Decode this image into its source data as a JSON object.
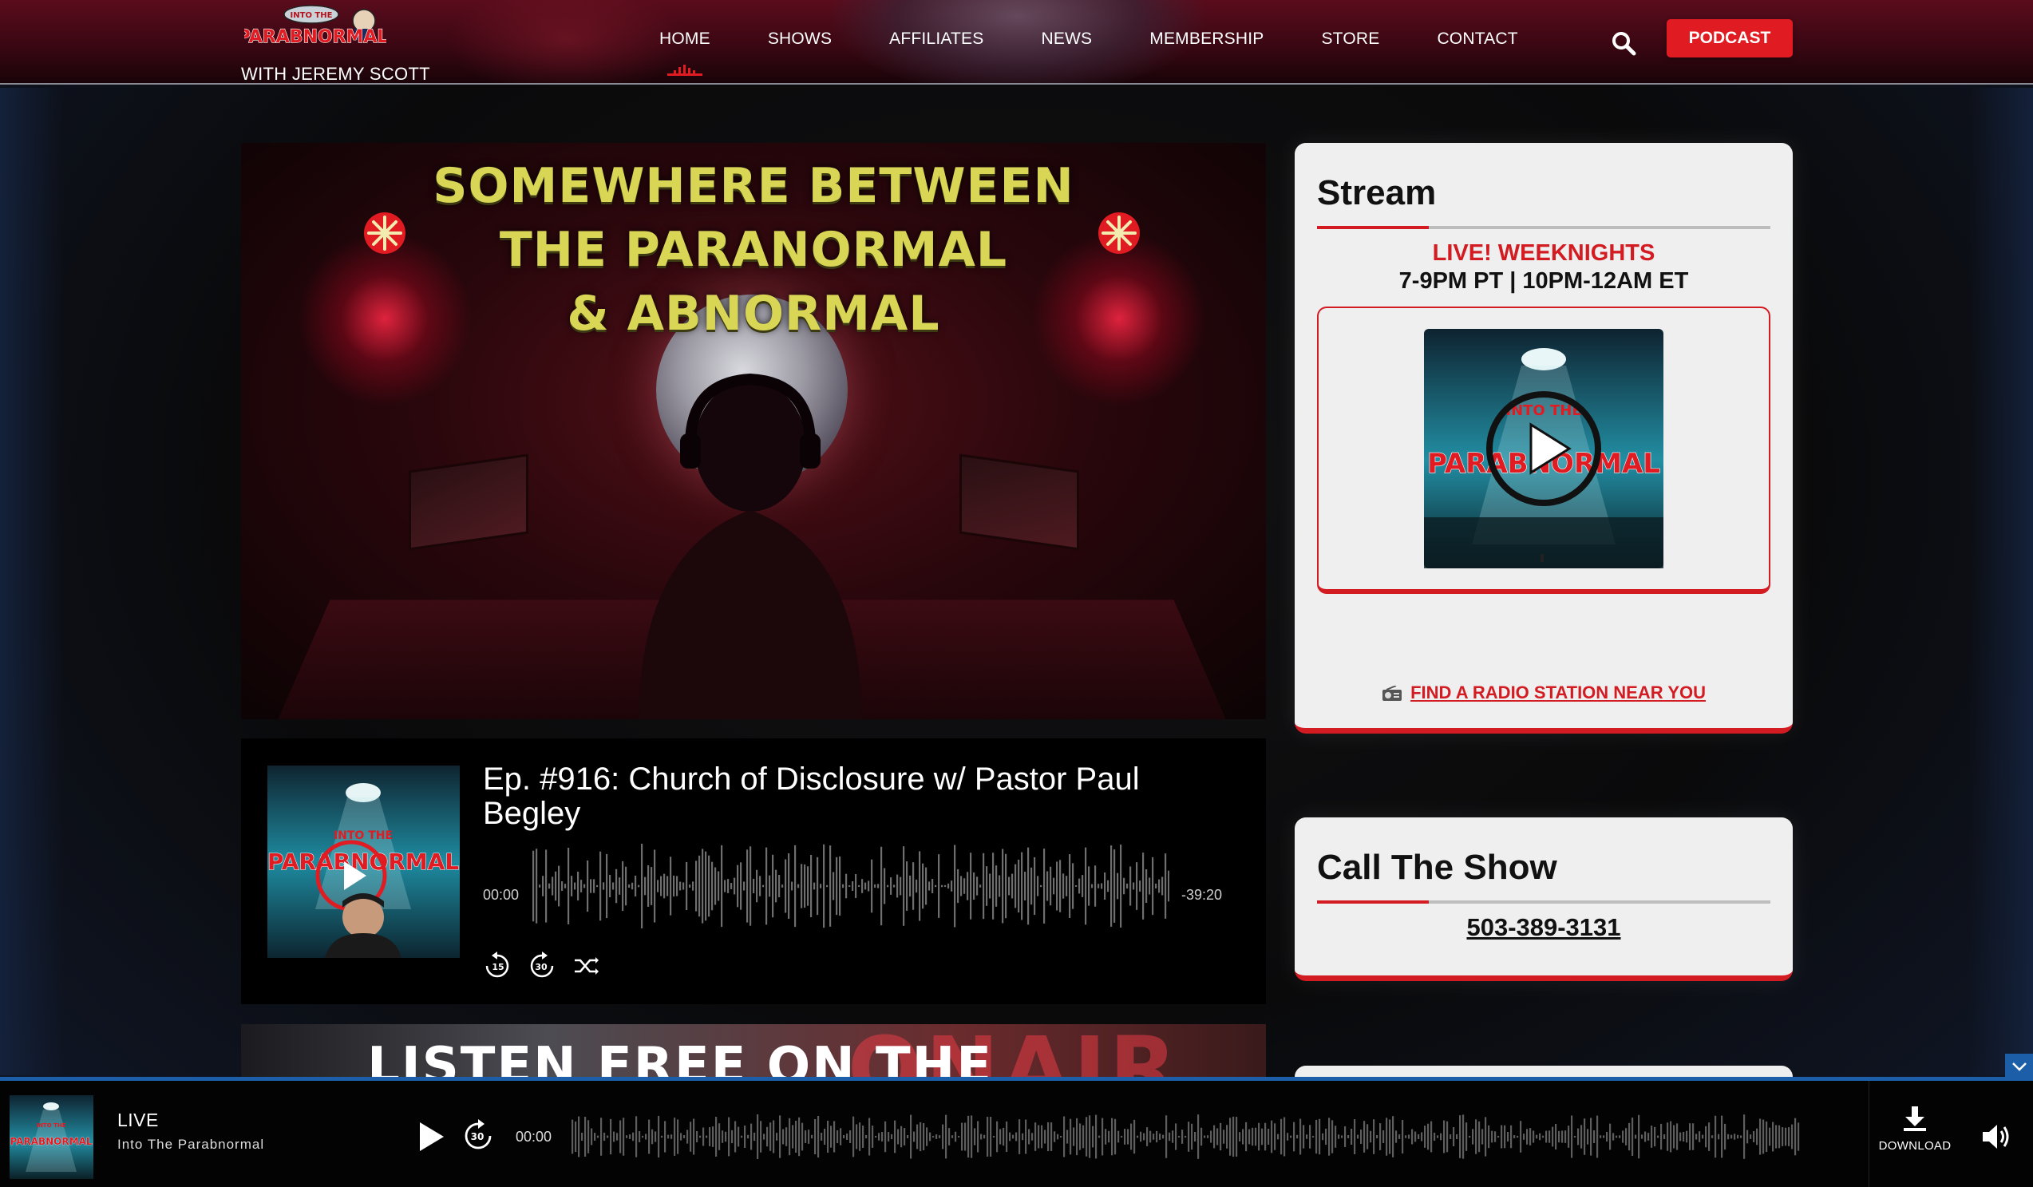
{
  "header": {
    "logo_text": "PARABNORMAL",
    "logo_subtitle": "WITH JEREMY SCOTT",
    "nav": [
      {
        "label": "HOME",
        "active": true
      },
      {
        "label": "SHOWS",
        "active": false
      },
      {
        "label": "AFFILIATES",
        "active": false
      },
      {
        "label": "NEWS",
        "active": false
      },
      {
        "label": "MEMBERSHIP",
        "active": false
      },
      {
        "label": "STORE",
        "active": false
      },
      {
        "label": "CONTACT",
        "active": false
      }
    ],
    "search_icon": "search-icon",
    "podcast_label": "PODCAST",
    "accent_color": "#e11b22"
  },
  "hero": {
    "title_lines": [
      "SOMEWHERE BETWEEN",
      "THE PARANORMAL",
      "& ABNORMAL"
    ],
    "title_color": "#d9d655"
  },
  "episode": {
    "title": "Ep. #916: Church of Disclosure w/ Pastor Paul Begley",
    "cover_text": "PARABNORMAL",
    "time_start": "00:00",
    "time_end": "-39:20",
    "controls": [
      "rewind-15-icon",
      "forward-30-icon",
      "shuffle-icon"
    ],
    "rewind_label": "15",
    "forward_label": "30"
  },
  "hero2": {
    "text": "LISTEN FREE ON THE",
    "bg_text": "ONAIR"
  },
  "stream_card": {
    "title": "Stream",
    "live_label": "LIVE! WEEKNIGHTS",
    "times": "7-9PM PT | 10PM-12AM ET",
    "art_text": "PARABNORMAL",
    "link_label": "FIND A RADIO STATION NEAR YOU"
  },
  "call_card": {
    "title": "Call The Show",
    "phone": "503-389-3131"
  },
  "player": {
    "cover_text": "PARABNORMAL",
    "live_label": "LIVE",
    "show_name": "Into The Parabnormal",
    "skip_label": "30",
    "time": "00:00",
    "download_label": "DOWNLOAD"
  }
}
